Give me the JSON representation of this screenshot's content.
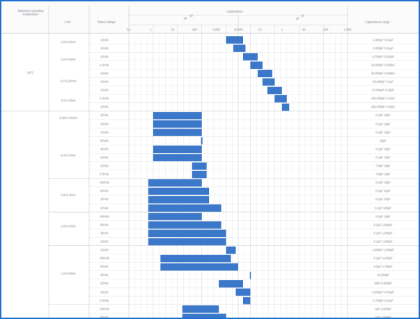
{
  "chart_data": {
    "type": "bar",
    "title": "",
    "header_row1": {
      "temp": "Maximum operating temperature",
      "lw": "L×W",
      "voltage": "Rated voltage",
      "cap": "Capacitance",
      "range": "Capacitance range"
    },
    "cap_units": [
      "pF",
      "μF"
    ],
    "exp_group1": "10",
    "exp_group2": "10",
    "scale_ticks": [
      "0.1",
      "1",
      "10",
      "100",
      "1,000",
      "10,000",
      "0.1",
      "1",
      "10",
      "100",
      "1,000"
    ],
    "scale_min_log": -1,
    "scale_max_log": 8,
    "temp_label": "85°C",
    "row_labels": [
      "1.6×0.8mm",
      "1.6×0.8mm",
      "2.0×1.25mm",
      "3.2×1.6mm",
      "0.38×0.18mm",
      "0.4×0.2mm",
      "0.6×0.3mm",
      "1.0×0.5mm",
      "1.6×0.8mm"
    ],
    "rows": [
      {
        "v": "16Vdc",
        "lo": 3.0,
        "hi": 3.7,
        "range": "1,000pF  0.01μF"
      },
      {
        "v": "16Vdc",
        "lo": 3.3,
        "hi": 3.8,
        "range": "2,200pF  0.01μF"
      },
      {
        "v": "10Vdc",
        "lo": 3.7,
        "hi": 4.3,
        "range": "4,700pF  0.022μF"
      },
      {
        "v": "6.3Vdc",
        "lo": 4.0,
        "hi": 4.5,
        "range": "10,000pF  0.033μF"
      },
      {
        "v": "16Vdc",
        "lo": 4.3,
        "hi": 4.9,
        "range": "22,000pF  0.068μF"
      },
      {
        "v": "16Vdc",
        "lo": 4.5,
        "hi": 5.0,
        "range": "33,000pF  0.1μF"
      },
      {
        "v": "10Vdc",
        "lo": 4.7,
        "hi": 5.3,
        "range": "47,000pF  0.15μF"
      },
      {
        "v": "6.3Vdc",
        "lo": 5.0,
        "hi": 5.5,
        "range": "100,000pF  0.22μF"
      },
      {
        "v": "16Vdc",
        "lo": 5.3,
        "hi": 5.6,
        "range": "150,000pF  0.33μF"
      },
      {
        "v": "25Vdc",
        "lo": 0.0,
        "hi": 2.0,
        "range": "0.1pF  15pF"
      },
      {
        "v": "16Vdc",
        "lo": 0.0,
        "hi": 2.0,
        "range": "0.1pF  15pF"
      },
      {
        "v": "10Vdc",
        "lo": 0.0,
        "hi": 2.0,
        "range": "0.1pF  15pF"
      },
      {
        "v": "50Vdc",
        "lo": 1.97,
        "hi": 2.03,
        "range": "10pF"
      },
      {
        "v": "25Vdc",
        "lo": 0.0,
        "hi": 2.0,
        "range": "0.1pF  15pF"
      },
      {
        "v": "16Vdc",
        "lo": 0.0,
        "hi": 2.0,
        "range": "0.1pF  15pF"
      },
      {
        "v": "10Vdc",
        "lo": 1.6,
        "hi": 2.2,
        "range": "7.5pF  15pF"
      },
      {
        "v": "6.3Vdc",
        "lo": 1.6,
        "hi": 2.2,
        "range": "7.5pF  15pF"
      },
      {
        "v": "100Vdc",
        "lo": -0.2,
        "hi": 2.0,
        "range": "0.1pF  15pF"
      },
      {
        "v": "50Vdc",
        "lo": -0.2,
        "hi": 2.3,
        "range": "0.1pF  22pF"
      },
      {
        "v": "25Vdc",
        "lo": -0.2,
        "hi": 2.3,
        "range": "0.1pF  33pF"
      },
      {
        "v": "16Vdc",
        "lo": -0.2,
        "hi": 2.8,
        "range": "0.1pF  100pF"
      },
      {
        "v": "100Vdc",
        "lo": -0.2,
        "hi": 2.0,
        "range": "0.1pF  15pF"
      },
      {
        "v": "50Vdc",
        "lo": -0.2,
        "hi": 2.8,
        "range": "0.1pF  1,000pF"
      },
      {
        "v": "25Vdc",
        "lo": -0.2,
        "hi": 3.0,
        "range": "0.1pF  1,000pF"
      },
      {
        "v": "16Vdc",
        "lo": -0.2,
        "hi": 3.0,
        "range": "0.1pF  1,000pF"
      },
      {
        "v": "10Vdc",
        "lo": 3.0,
        "hi": 3.4,
        "range": "1,000pF  2,200pF"
      },
      {
        "v": "100Vdc",
        "lo": 0.3,
        "hi": 3.2,
        "range": "0.1pF  2,200pF"
      },
      {
        "v": "50Vdc",
        "lo": 0.3,
        "hi": 3.5,
        "range": "0.5pF  4,700pF"
      },
      {
        "v": "25Vdc",
        "lo": 3.98,
        "hi": 4.02,
        "range": "10,000pF"
      },
      {
        "v": "16Vdc",
        "lo": 2.7,
        "hi": 3.7,
        "range": "10pF  6,800pF"
      },
      {
        "v": "16Vdc",
        "lo": 3.4,
        "hi": 4.0,
        "range": "3,300pF  0.033μF"
      },
      {
        "v": "6.3Vdc",
        "lo": 3.7,
        "hi": 4.0,
        "range": "4,700pF  0.01μF"
      },
      {
        "v": "100Vdc",
        "lo": 1.2,
        "hi": 2.7,
        "range": "1pF  1,000pF"
      },
      {
        "v": "50Vdc",
        "lo": 1.2,
        "hi": 3.0,
        "range": "1pF  1,000pF"
      }
    ]
  }
}
